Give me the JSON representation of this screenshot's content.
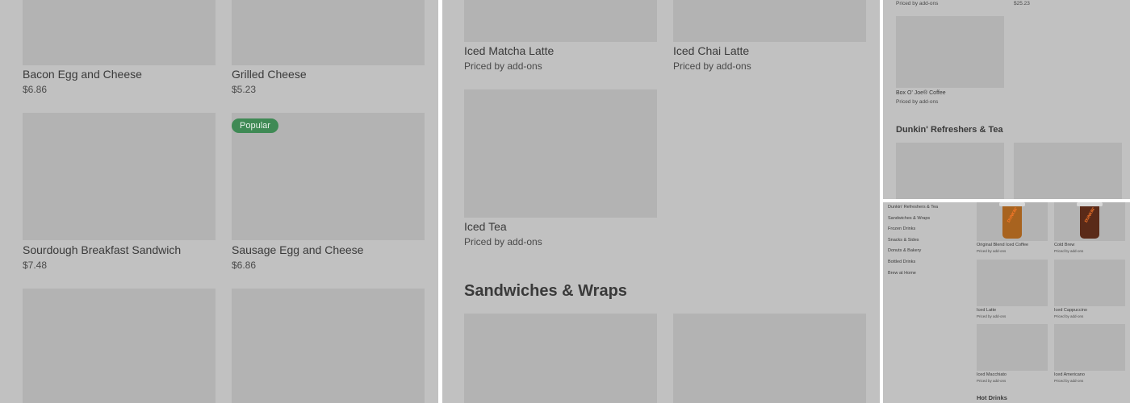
{
  "panel1": {
    "items": [
      {
        "name": "Bacon Egg and Cheese",
        "price": "$6.86"
      },
      {
        "name": "Grilled Cheese",
        "price": "$5.23"
      },
      {
        "name": "Sourdough Breakfast Sandwich",
        "price": "$7.48"
      },
      {
        "name": "Sausage Egg and Cheese",
        "price": "$6.86"
      }
    ],
    "popular_badge": "Popular"
  },
  "panel2": {
    "items": [
      {
        "name": "Iced Matcha Latte",
        "price": "Priced by add-ons"
      },
      {
        "name": "Iced Chai Latte",
        "price": "Priced by add-ons"
      },
      {
        "name": "Iced Tea",
        "price": "Priced by add-ons"
      }
    ],
    "section_title": "Sandwiches & Wraps"
  },
  "panel3": {
    "top_price_left": "Priced by add-ons",
    "top_price_right": "$25.23",
    "item": {
      "name": "Box O' Joe® Coffee",
      "price": "Priced by add-ons"
    },
    "section_title": "Dunkin' Refreshers & Tea"
  },
  "panel4": {
    "nav": [
      "Dunkin' Refreshers & Tea",
      "Sandwiches & Wraps",
      "Frozen Drinks",
      "Snacks & Sides",
      "Donuts & Bakery",
      "Bottled Drinks",
      "Brew at Home"
    ],
    "items": [
      {
        "name": "Original Blend Iced Coffee",
        "price": "Priced by add-ons"
      },
      {
        "name": "Cold Brew",
        "price": "Priced by add-ons"
      },
      {
        "name": "Iced Latte",
        "price": "Priced by add-ons"
      },
      {
        "name": "Iced Cappuccino",
        "price": "Priced by add-ons"
      },
      {
        "name": "Iced Macchiato",
        "price": "Priced by add-ons"
      },
      {
        "name": "Iced Americano",
        "price": "Priced by add-ons"
      }
    ],
    "cup_label": "DUNKIN'",
    "section_title": "Hot Drinks"
  },
  "colors": {
    "overlay": "#c1c1c1",
    "image_placeholder": "#b3b3b3",
    "badge": "#3f8a55",
    "divider": "#ffffff"
  }
}
